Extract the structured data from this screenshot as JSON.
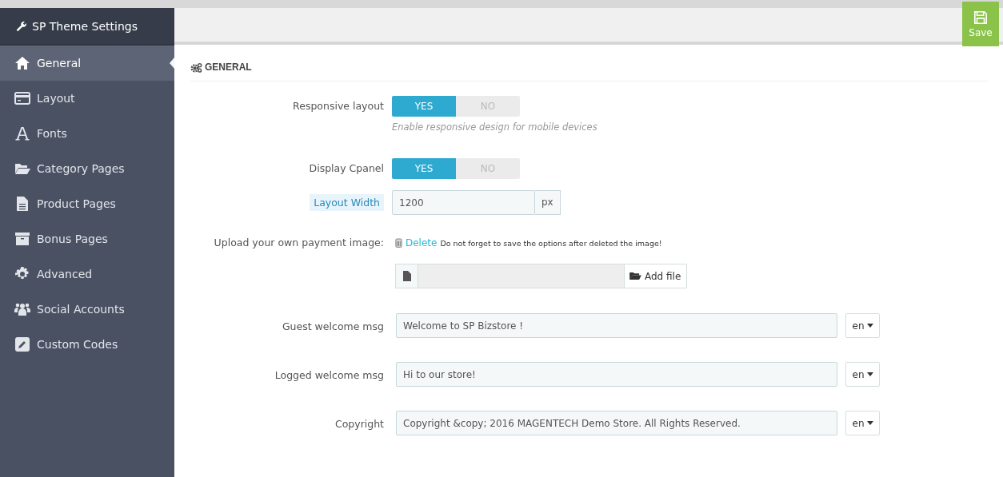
{
  "sidebar": {
    "title": "SP Theme Settings",
    "items": [
      {
        "label": "General",
        "selected": true
      },
      {
        "label": "Layout",
        "selected": false
      },
      {
        "label": "Fonts",
        "selected": false
      },
      {
        "label": "Category Pages",
        "selected": false
      },
      {
        "label": "Product Pages",
        "selected": false
      },
      {
        "label": "Bonus Pages",
        "selected": false
      },
      {
        "label": "Advanced",
        "selected": false
      },
      {
        "label": "Social Accounts",
        "selected": false
      },
      {
        "label": "Custom Codes",
        "selected": false
      }
    ]
  },
  "toolbar": {
    "save": "Save"
  },
  "section": {
    "title": "GENERAL"
  },
  "fields": [
    {
      "kind": "toggle",
      "label": "Responsive layout",
      "options": [
        {
          "label": "YES",
          "selected": true
        },
        {
          "label": "NO",
          "selected": false
        }
      ],
      "hint": "Enable responsive design for mobile devices"
    },
    {
      "kind": "toggle",
      "label": "Display Cpanel",
      "options": [
        {
          "label": "YES",
          "selected": true
        },
        {
          "label": "NO",
          "selected": false
        }
      ]
    },
    {
      "kind": "addon",
      "label": "Layout Width",
      "value": "1200",
      "addon": "px"
    },
    {
      "kind": "upload",
      "label": "Upload your own payment image:",
      "delete": "Delete",
      "note": "Do not forget to save the options after deleted the image!",
      "button": "Add file"
    },
    {
      "kind": "lang",
      "label": "Guest welcome msg",
      "value": "Welcome to SP Bizstore !",
      "lang": "en"
    },
    {
      "kind": "lang",
      "label": "Logged welcome msg",
      "value": "Hi to our store!",
      "lang": "en"
    },
    {
      "kind": "lang",
      "label": "Copyright",
      "value": "Copyright &copy; 2016 MAGENTECH Demo Store. All Rights Reserved.",
      "lang": "en"
    }
  ]
}
